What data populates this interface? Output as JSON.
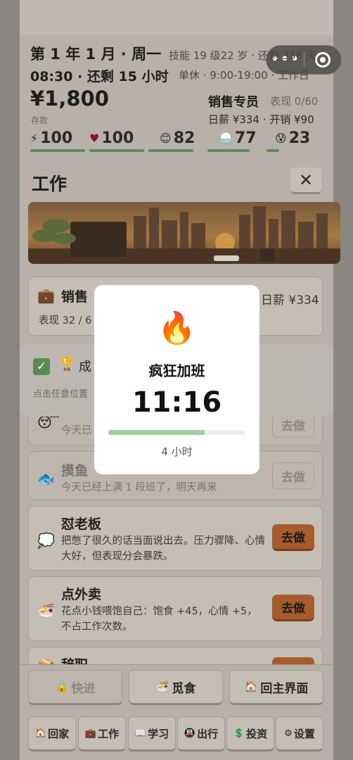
{
  "capsule": {
    "more_label": "•••"
  },
  "header": {
    "date": "第 1 年 1 月 · 周一",
    "time": "08:30 · 还剩 15 小时",
    "skill_age": "技能 19 级22 岁 · 还剩 336 天",
    "schedule": "单休 · 9:00-19:00 · 工作日",
    "money": "¥1,800",
    "savings_label": "存款",
    "job_title": "销售专员",
    "job_perf": "表现 0/60",
    "job_pay": "日薪 ¥334 · 开销 ¥90"
  },
  "stats": [
    {
      "icon": "⚡",
      "value": "100",
      "level": 1.0,
      "color": "#e6a21a"
    },
    {
      "icon": "♥",
      "value": "100",
      "level": 1.0,
      "color": "#b0122e"
    },
    {
      "icon": "😊",
      "value": "82",
      "level": 0.82,
      "color": "#e0a12b"
    },
    {
      "icon": "🍚",
      "value": "77",
      "level": 0.77,
      "color": "#b8423b"
    },
    {
      "icon": "😰",
      "value": "23",
      "level": 0.23,
      "color": "#4d6b8a"
    }
  ],
  "work": {
    "title": "工作",
    "close": "✕"
  },
  "job_card": {
    "icon": "💼",
    "name": "销售",
    "pay": "日薪 ¥334",
    "perf": "表现 32 / 6"
  },
  "toast": {
    "check": "✓",
    "icon": "🏆",
    "message": "成",
    "hint": "点击任意位置"
  },
  "modal": {
    "icon": "🔥",
    "title": "疯狂加班",
    "clock": "11:16",
    "duration": "4 小时",
    "progress": 0.7
  },
  "cards": [
    {
      "icon": "😴",
      "name": "",
      "desc": "今天已",
      "button": "去做",
      "enabled": false
    },
    {
      "icon": "🐟",
      "name": "摸鱼",
      "desc": "今天已经上满 1 段班了，明天再来",
      "button": "去做",
      "enabled": false
    },
    {
      "icon": "💭",
      "name": "怼老板",
      "desc": "把憋了很久的话当面说出去。压力骤降、心情大好，但表现分会暴跌。",
      "button": "去做",
      "enabled": true
    },
    {
      "icon": "🍜",
      "name": "点外卖",
      "desc": "花点小钱喂饱自己：饱食 +45，心情 +5，不占工作次数。",
      "button": "去做",
      "enabled": true
    },
    {
      "icon": "📦",
      "name": "辞职",
      "desc": "",
      "button": "去做",
      "enabled": true
    }
  ],
  "actions": [
    {
      "icon": "🔒",
      "label": "快进",
      "enabled": false
    },
    {
      "icon": "🍜",
      "label": "觅食",
      "enabled": true
    },
    {
      "icon": "🏠",
      "label": "回主界面",
      "enabled": true
    }
  ],
  "nav": [
    {
      "icon": "🏠",
      "label": "回家"
    },
    {
      "icon": "💼",
      "label": "工作"
    },
    {
      "icon": "📖",
      "label": "学习"
    },
    {
      "icon": "🚇",
      "label": "出行"
    },
    {
      "icon": "💲",
      "label": "投资"
    },
    {
      "icon": "⚙",
      "label": "设置"
    }
  ]
}
